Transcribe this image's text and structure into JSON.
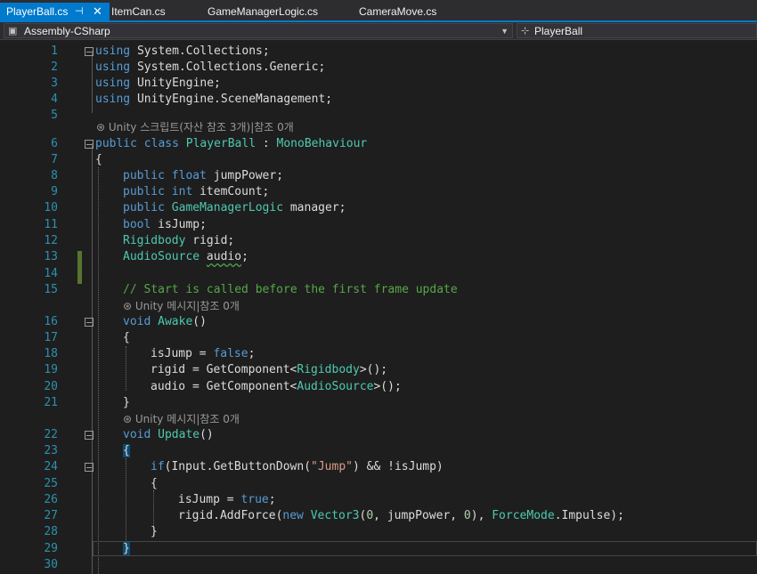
{
  "tabs": [
    {
      "label": "PlayerBall.cs",
      "active": true,
      "pin_icon": "pin-icon",
      "close_icon": "close-icon",
      "pin_glyph": "⊣",
      "close_glyph": "✕"
    },
    {
      "label": "ItemCan.cs"
    },
    {
      "label": "GameManagerLogic.cs"
    },
    {
      "label": "CameraMove.cs"
    }
  ],
  "nav": {
    "project": "Assembly-CSharp",
    "project_icon": "csharp-project-icon",
    "member": "PlayerBall",
    "member_icon": "class-icon",
    "dropdown_icon": "chevron-down-icon"
  },
  "lens": {
    "class_refs": "⊛ Unity 스크립트(자산 참조 3개)|참조 0개",
    "awake_refs": "⊛ Unity 메시지|참조 0개",
    "update_refs": "⊛ Unity 메시지|참조 0개"
  },
  "colors": {
    "accent": "#007acc",
    "keyword": "#569cd6",
    "type": "#4ec9b0",
    "comment": "#57a64a",
    "string": "#d69d85",
    "line_number": "#2b91af",
    "change_bar": "#577430"
  },
  "lines": [
    {
      "n": "1",
      "fold": true,
      "tokens": [
        [
          "kw",
          "using"
        ],
        [
          "",
          "System.Collections;"
        ]
      ]
    },
    {
      "n": "2",
      "tokens": [
        [
          "kw",
          "using"
        ],
        [
          "",
          "System.Collections.Generic;"
        ]
      ]
    },
    {
      "n": "3",
      "tokens": [
        [
          "kw",
          "using"
        ],
        [
          "",
          "UnityEngine;"
        ]
      ]
    },
    {
      "n": "4",
      "tokens": [
        [
          "kw",
          "using"
        ],
        [
          "",
          "UnityEngine.SceneManagement;"
        ]
      ]
    },
    {
      "n": "5",
      "tokens": []
    },
    {
      "n": "6",
      "fold": true,
      "lens_before": "class_refs",
      "tokens": [
        [
          "kw",
          "public"
        ],
        [
          "kw",
          "class"
        ],
        [
          "ty",
          "PlayerBall"
        ],
        [
          "",
          ":"
        ],
        [
          "ty",
          "MonoBehaviour"
        ]
      ]
    },
    {
      "n": "7",
      "tokens": [
        [
          "",
          "{"
        ]
      ]
    },
    {
      "n": "8",
      "tokens": [
        [
          "kw",
          "public"
        ],
        [
          "kw",
          "float"
        ],
        [
          "",
          "jumpPower;"
        ]
      ]
    },
    {
      "n": "9",
      "tokens": [
        [
          "kw",
          "public"
        ],
        [
          "kw",
          "int"
        ],
        [
          "",
          "itemCount;"
        ]
      ]
    },
    {
      "n": "10",
      "tokens": [
        [
          "kw",
          "public"
        ],
        [
          "ty",
          "GameManagerLogic"
        ],
        [
          "",
          "manager;"
        ]
      ]
    },
    {
      "n": "11",
      "tokens": [
        [
          "kw",
          "bool"
        ],
        [
          "",
          "isJump;"
        ]
      ]
    },
    {
      "n": "12",
      "tokens": [
        [
          "ty",
          "Rigidbody"
        ],
        [
          "",
          "rigid;"
        ]
      ]
    },
    {
      "n": "13",
      "tokens": [
        [
          "ty",
          "AudioSource"
        ],
        [
          "sq",
          "audio"
        ],
        [
          "",
          ";"
        ]
      ]
    },
    {
      "n": "14",
      "tokens": []
    },
    {
      "n": "15",
      "tokens": [
        [
          "cm",
          "// Start is called before the first frame update"
        ]
      ]
    },
    {
      "n": "16",
      "fold": true,
      "lens_before": "awake_refs",
      "tokens": [
        [
          "kw",
          "void"
        ],
        [
          "ty",
          "Awake"
        ],
        [
          "",
          "()"
        ]
      ]
    },
    {
      "n": "17",
      "tokens": [
        [
          "",
          "{"
        ]
      ]
    },
    {
      "n": "18",
      "tokens": [
        [
          "",
          "isJump ="
        ],
        [
          "kw",
          "false"
        ],
        [
          "",
          ";"
        ]
      ]
    },
    {
      "n": "19",
      "tokens": [
        [
          "",
          "rigid = GetComponent<"
        ],
        [
          "ty",
          "Rigidbody"
        ],
        [
          "",
          ">();"
        ]
      ]
    },
    {
      "n": "20",
      "tokens": [
        [
          "",
          "audio = GetComponent<"
        ],
        [
          "ty",
          "AudioSource"
        ],
        [
          "",
          ">();"
        ]
      ]
    },
    {
      "n": "21",
      "tokens": [
        [
          "",
          "}"
        ]
      ]
    },
    {
      "n": "22",
      "fold": true,
      "lens_before": "update_refs",
      "tokens": [
        [
          "kw",
          "void"
        ],
        [
          "ty",
          "Update"
        ],
        [
          "",
          "()"
        ]
      ]
    },
    {
      "n": "23",
      "tokens": [
        [
          "hl",
          "{"
        ]
      ]
    },
    {
      "n": "24",
      "fold": true,
      "tokens": [
        [
          "kw",
          "if"
        ],
        [
          "",
          "(Input.GetButtonDown("
        ],
        [
          "st",
          "\"Jump\""
        ],
        [
          "",
          ") && !isJump)"
        ]
      ]
    },
    {
      "n": "25",
      "tokens": [
        [
          "",
          "{"
        ]
      ]
    },
    {
      "n": "26",
      "tokens": [
        [
          "",
          "isJump ="
        ],
        [
          "kw",
          "true"
        ],
        [
          "",
          ";"
        ]
      ]
    },
    {
      "n": "27",
      "tokens": [
        [
          "",
          "rigid.AddForce("
        ],
        [
          "kw",
          "new"
        ],
        [
          "ty",
          "Vector3"
        ],
        [
          "",
          "("
        ],
        [
          "nm",
          "0"
        ],
        [
          "",
          ", jumpPower,"
        ],
        [
          "nm",
          "0"
        ],
        [
          "",
          "),"
        ],
        [
          "ty",
          "ForceMode"
        ],
        [
          "",
          ".Impulse);"
        ]
      ]
    },
    {
      "n": "28",
      "tokens": [
        [
          "",
          "}"
        ]
      ]
    },
    {
      "n": "29",
      "tokens": [
        [
          "hl",
          "}"
        ]
      ]
    },
    {
      "n": "30",
      "tokens": []
    }
  ]
}
